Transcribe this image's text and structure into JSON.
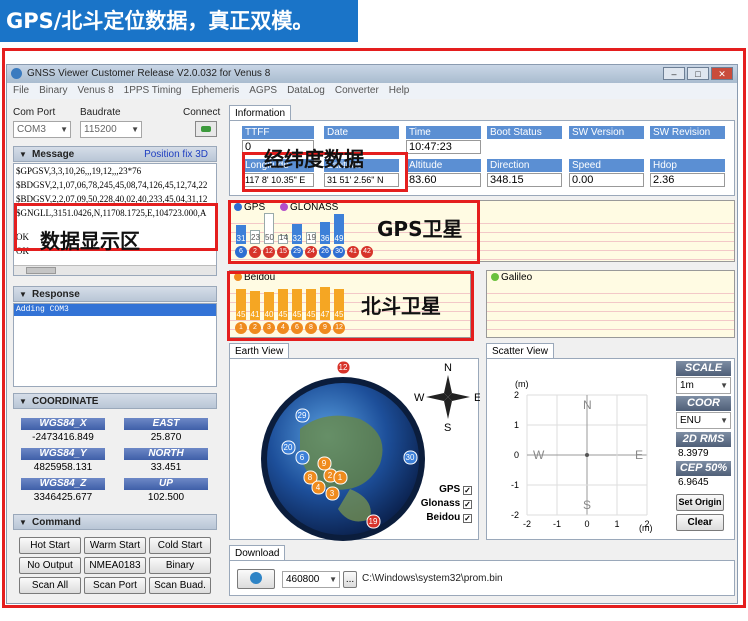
{
  "banner": "GPS/北斗定位数据，真正双模。",
  "window": {
    "title": "GNSS Viewer Customer Release V2.0.032 for Venus 8"
  },
  "menu": [
    "File",
    "Binary",
    "Venus 8",
    "1PPS Timing",
    "Ephemeris",
    "AGPS",
    "DataLog",
    "Converter",
    "Help"
  ],
  "connection": {
    "com_port_label": "Com Port",
    "com_port": "COM3",
    "baudrate_label": "Baudrate",
    "baudrate": "115200",
    "connect_label": "Connect"
  },
  "message": {
    "header": "Message",
    "status": "Position fix 3D",
    "lines": [
      "$GPGSV,3,3,10,26,,,19,12,,,23*76",
      "$BDGSV,2,1,07,06,78,245,45,08,74,126,45,12,74,22",
      "$BDGSV,2,2,07,09,50,228,40,02,40,233,45,04,31,12",
      "$GNGLL,3151.0426,N,11708.1725,E,104723.000,A",
      "OK",
      "OK"
    ]
  },
  "response": {
    "header": "Response",
    "lines": [
      "Adding COM3"
    ]
  },
  "coordinate": {
    "header": "COORDINATE",
    "items": [
      {
        "label": "WGS84_X",
        "value": "-2473416.849"
      },
      {
        "label": "EAST",
        "value": "25.870"
      },
      {
        "label": "WGS84_Y",
        "value": "4825958.131"
      },
      {
        "label": "NORTH",
        "value": "33.451"
      },
      {
        "label": "WGS84_Z",
        "value": "3346425.677"
      },
      {
        "label": "UP",
        "value": "102.500"
      }
    ]
  },
  "command": {
    "header": "Command",
    "buttons": [
      "Hot Start",
      "Warm Start",
      "Cold Start",
      "No Output",
      "NMEA0183",
      "Binary",
      "Scan All",
      "Scan Port",
      "Scan Buad."
    ]
  },
  "information": {
    "tab": "Information",
    "fields": [
      {
        "label": "TTFF",
        "value": "0"
      },
      {
        "label": "Date",
        "value": ""
      },
      {
        "label": "Time",
        "value": "10:47:23"
      },
      {
        "label": "Boot Status",
        "value": ""
      },
      {
        "label": "SW Version",
        "value": ""
      },
      {
        "label": "SW Revision",
        "value": ""
      },
      {
        "label": "Longitude",
        "value": "117 8' 10.35\" E"
      },
      {
        "label": "Latitude",
        "value": "31 51' 2.56\" N"
      },
      {
        "label": "Altitude",
        "value": "83.60"
      },
      {
        "label": "Direction",
        "value": "348.15"
      },
      {
        "label": "Speed",
        "value": "0.00"
      },
      {
        "label": "Hdop",
        "value": "2.36"
      }
    ]
  },
  "gps_panel": {
    "legend_gps": "GPS",
    "legend_glonass": "GLONASS",
    "bars": [
      {
        "snr": "31",
        "prn": "6",
        "used": true
      },
      {
        "snr": "23",
        "prn": "2",
        "used": false
      },
      {
        "snr": "50",
        "prn": "12",
        "used": false
      },
      {
        "snr": "14",
        "prn": "15",
        "used": false
      },
      {
        "snr": "32",
        "prn": "29",
        "used": true
      },
      {
        "snr": "19",
        "prn": "24",
        "used": false
      },
      {
        "snr": "36",
        "prn": "26",
        "used": true
      },
      {
        "snr": "49",
        "prn": "30",
        "used": true
      },
      {
        "snr": "",
        "prn": "41",
        "used": false
      },
      {
        "snr": "",
        "prn": "42",
        "used": false
      }
    ]
  },
  "beidou_panel": {
    "legend": "Beidou",
    "bars": [
      {
        "snr": "45",
        "prn": "1"
      },
      {
        "snr": "41",
        "prn": "2"
      },
      {
        "snr": "40",
        "prn": "3"
      },
      {
        "snr": "45",
        "prn": "4"
      },
      {
        "snr": "45",
        "prn": "6"
      },
      {
        "snr": "45",
        "prn": "8"
      },
      {
        "snr": "47",
        "prn": "9"
      },
      {
        "snr": "45",
        "prn": "12"
      }
    ]
  },
  "galileo_panel": {
    "legend": "Galileo"
  },
  "annotations": {
    "lonlat": "经纬度数据",
    "message": "数据显示区",
    "gps": "GPS卫星",
    "beidou": "北斗卫星"
  },
  "earth_view": {
    "title": "Earth View",
    "compass": {
      "n": "N",
      "s": "S",
      "e": "E",
      "w": "W"
    },
    "sats": [
      {
        "prn": "12",
        "kind": "glonass"
      },
      {
        "prn": "29",
        "kind": "gps"
      },
      {
        "prn": "20",
        "kind": "gps"
      },
      {
        "prn": "6",
        "kind": "gps"
      },
      {
        "prn": "30",
        "kind": "gps"
      },
      {
        "prn": "9",
        "kind": "beidou"
      },
      {
        "prn": "2",
        "kind": "beidou"
      },
      {
        "prn": "8",
        "kind": "beidou"
      },
      {
        "prn": "4",
        "kind": "beidou"
      },
      {
        "prn": "1",
        "kind": "beidou"
      },
      {
        "prn": "3",
        "kind": "beidou"
      },
      {
        "prn": "19",
        "kind": "glonass"
      }
    ],
    "filters": [
      {
        "label": "GPS",
        "checked": true
      },
      {
        "label": "Glonass",
        "checked": true
      },
      {
        "label": "Beidou",
        "checked": true
      }
    ]
  },
  "scatter_view": {
    "title": "Scatter View",
    "ylabel": "(m)",
    "xlabel": "(m)",
    "yticks": [
      "2",
      "1",
      "0",
      "-1",
      "-2"
    ],
    "xticks": [
      "-2",
      "-1",
      "0",
      "1",
      "2"
    ],
    "compass": {
      "n": "N",
      "s": "S",
      "e": "E",
      "w": "W"
    },
    "scale_label": "SCALE",
    "scale_value": "1m",
    "coor_label": "COOR",
    "coor_value": "ENU",
    "rms_label": "2D RMS",
    "rms_value": "8.3979",
    "cep_label": "CEP 50%",
    "cep_value": "6.9645",
    "set_origin": "Set Origin",
    "clear": "Clear"
  },
  "download": {
    "tab": "Download",
    "baud": "460800",
    "browse": "...",
    "path": "C:\\Windows\\system32\\prom.bin"
  }
}
